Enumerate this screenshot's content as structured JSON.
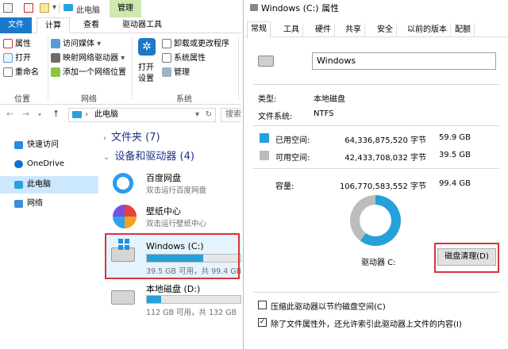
{
  "explorer": {
    "title": "此电脑",
    "manage_tab": "管理",
    "tabs": [
      "文件",
      "计算机",
      "查看",
      "驱动器工具"
    ],
    "ribbon": {
      "location_items": [
        "属性",
        "打开",
        "重命名"
      ],
      "location_group": "位置",
      "network_items": [
        "访问媒体",
        "映射网络驱动器",
        "添加一个网络位置"
      ],
      "network_group": "网络",
      "open_settings": [
        "打开",
        "设置"
      ],
      "system_items": [
        "卸载或更改程序",
        "系统属性",
        "管理"
      ],
      "system_group": "系统"
    },
    "address": "此电脑",
    "search_placeholder": "搜索",
    "nav": [
      "快速访问",
      "OneDrive",
      "此电脑",
      "网络"
    ],
    "sections": {
      "folders": "文件夹 (7)",
      "devices": "设备和驱动器 (4)"
    },
    "devices": [
      {
        "name": "百度网盘",
        "sub": "双击运行百度网盘"
      },
      {
        "name": "壁纸中心",
        "sub": "双击运行壁纸中心"
      }
    ],
    "drives": [
      {
        "name": "Windows (C:)",
        "free": "39.5 GB 可用，共 99.4 GB",
        "used_fraction": 0.6
      },
      {
        "name": "本地磁盘 (D:)",
        "free": "112 GB 可用，共 132 GB",
        "used_fraction": 0.15
      }
    ]
  },
  "props": {
    "title": "Windows (C:) 属性",
    "tabs": [
      "常规",
      "工具",
      "硬件",
      "共享",
      "安全",
      "以前的版本",
      "配额"
    ],
    "name": "Windows",
    "type_label": "类型:",
    "type_value": "本地磁盘",
    "fs_label": "文件系统:",
    "fs_value": "NTFS",
    "used_label": "已用空间:",
    "used_bytes": "64,336,875,520 字节",
    "used_gb": "59.9 GB",
    "free_label": "可用空间:",
    "free_bytes": "42,433,708,032 字节",
    "free_gb": "39.5 GB",
    "cap_label": "容量:",
    "cap_bytes": "106,770,583,552 字节",
    "cap_gb": "99.4 GB",
    "drive_label": "驱动器 C:",
    "cleanup_button": "磁盘清理(D)",
    "compress_label": "压缩此驱动器以节约磁盘空间(C)",
    "index_label": "除了文件属性外，还允许索引此驱动器上文件的内容(I)",
    "used_fraction": 0.6026,
    "colors": {
      "used": "#26a0da",
      "free": "#bcbcbc",
      "highlight": "#d8343b"
    }
  }
}
